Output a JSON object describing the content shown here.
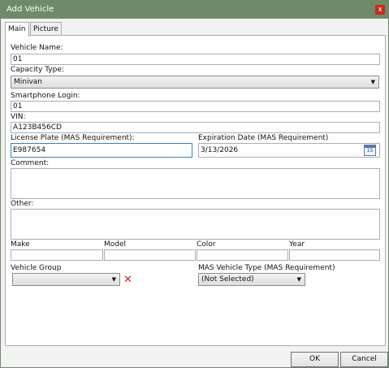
{
  "window": {
    "title": "Add Vehicle",
    "close_glyph": "x"
  },
  "tabs": [
    {
      "label": "Main",
      "active": true
    },
    {
      "label": "Picture",
      "active": false
    }
  ],
  "form": {
    "vehicle_name": {
      "label": "Vehicle Name:",
      "value": "01"
    },
    "capacity_type": {
      "label": "Capacity Type:",
      "value": "Minivan"
    },
    "smartphone_login": {
      "label": "Smartphone Login:",
      "value": "01"
    },
    "vin": {
      "label": "VIN:",
      "value": "A123B456CD"
    },
    "license_plate": {
      "label": "License Plate (MAS Requirement):",
      "value": "E987654"
    },
    "expiration_date": {
      "label": "Expiration Date (MAS Requirement)",
      "value": "3/13/2026",
      "calendar_day": "15"
    },
    "comment": {
      "label": "Comment:",
      "value": ""
    },
    "other": {
      "label": "Other:",
      "value": ""
    },
    "make": {
      "label": "Make",
      "value": ""
    },
    "model": {
      "label": "Model",
      "value": ""
    },
    "color": {
      "label": "Color",
      "value": ""
    },
    "year": {
      "label": "Year",
      "value": ""
    },
    "vehicle_group": {
      "label": "Vehicle Group",
      "value": ""
    },
    "mas_vehicle_type": {
      "label": "MAS Vehicle Type (MAS Requirement)",
      "value": "(Not Selected)"
    }
  },
  "buttons": {
    "ok": "OK",
    "cancel": "Cancel"
  },
  "icons": {
    "close": "close-icon",
    "dropdown": "chevron-down-icon",
    "calendar": "calendar-icon",
    "clear": "clear-x-icon"
  },
  "colors": {
    "titlebar": "#6d8b68",
    "close_button": "#c42b1c",
    "clear_icon": "#d82121",
    "focus_border": "#3c7fb1"
  }
}
